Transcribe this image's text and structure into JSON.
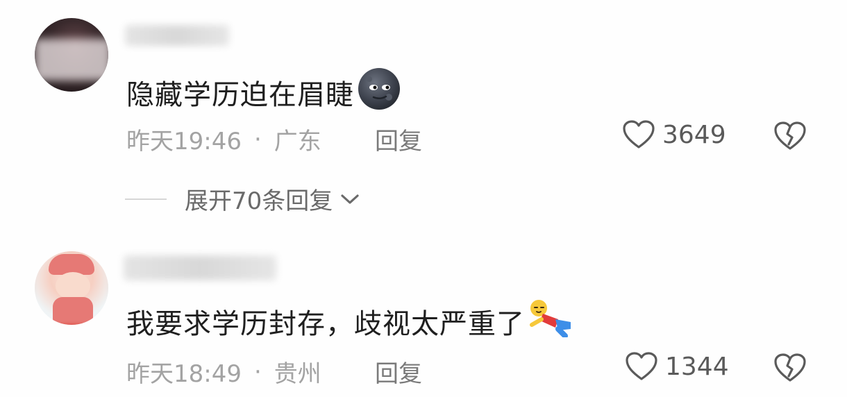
{
  "comments": [
    {
      "text": "隐藏学历迫在眉睫",
      "emoji": "moon-face-emoji",
      "time": "昨天19:46",
      "separator": "·",
      "location": "广东",
      "reply_label": "回复",
      "likes": "3649"
    },
    {
      "text": "我要求学历封存，歧视太严重了",
      "emoji": "lying-down-figure-emoji",
      "time": "昨天18:49",
      "separator": "·",
      "location": "贵州",
      "reply_label": "回复",
      "likes": "1344"
    }
  ],
  "expand_replies": {
    "label": "展开70条回复"
  },
  "colors": {
    "text": "#1f1f1f",
    "meta": "#a3a3a3",
    "reply": "#7a7a7a",
    "icon": "#5a5a5a"
  }
}
